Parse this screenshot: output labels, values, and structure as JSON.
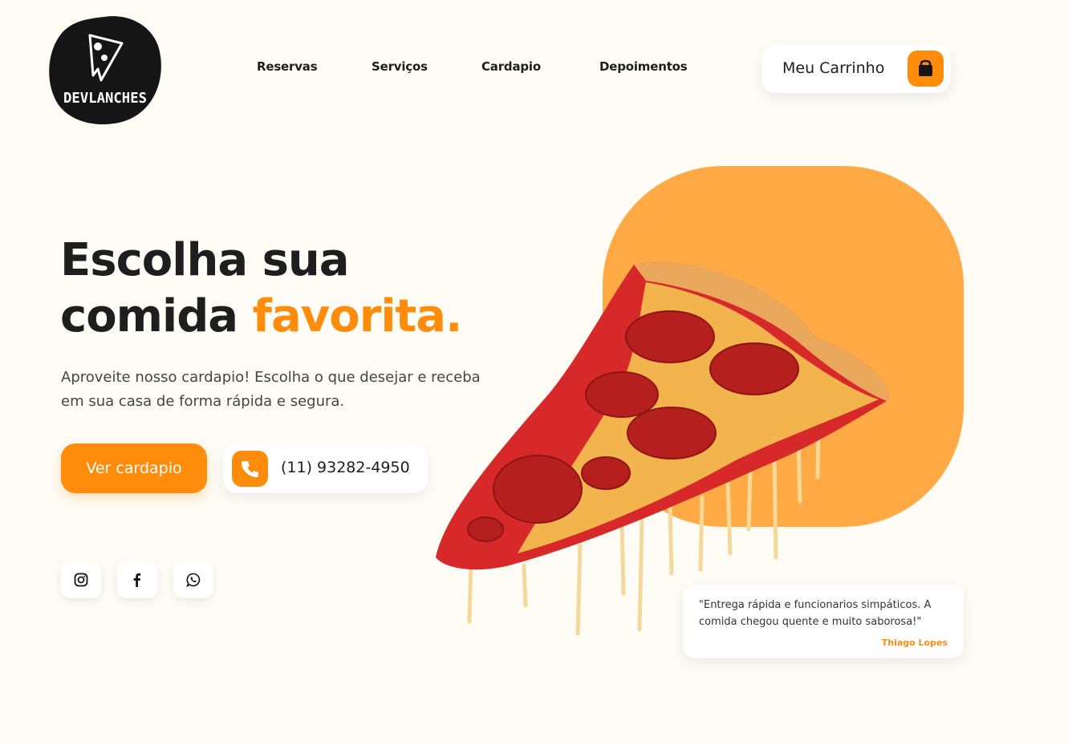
{
  "brand": {
    "name": "DEVLANCHES"
  },
  "nav": {
    "items": [
      {
        "label": "Reservas"
      },
      {
        "label": "Serviços"
      },
      {
        "label": "Cardapio"
      },
      {
        "label": "Depoimentos"
      }
    ]
  },
  "cart": {
    "label": "Meu Carrinho",
    "icon": "shopping-bag-icon"
  },
  "hero": {
    "title_line1": "Escolha sua",
    "title_line2_prefix": "comida ",
    "title_line2_accent": "favorita.",
    "subtitle": "Aproveite nosso cardapio! Escolha o que desejar e receba em sua casa de forma rápida e segura.",
    "menu_button": "Ver cardapio",
    "phone": "(11) 93282-4950",
    "phone_icon": "phone-icon"
  },
  "social": [
    {
      "icon": "instagram-icon"
    },
    {
      "icon": "facebook-icon"
    },
    {
      "icon": "whatsapp-icon"
    }
  ],
  "testimonial": {
    "text": "\"Entrega rápida e funcionarios simpáticos. A comida chegou quente e muito saborosa!\"",
    "author": "Thiago Lopes"
  },
  "colors": {
    "accent": "#ff8c0a",
    "blob": "#ffaa45",
    "background": "#fffcf6",
    "text": "#1e1e1e"
  }
}
